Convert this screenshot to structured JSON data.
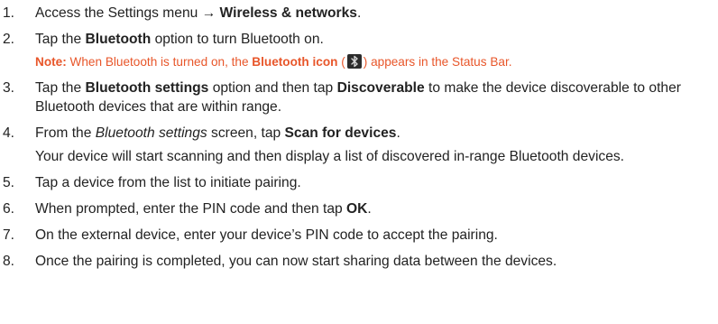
{
  "steps": [
    {
      "num": "1.",
      "pre": "Access the Settings menu → ",
      "b1": "Wireless & networks",
      "post": "."
    },
    {
      "num": "2.",
      "pre": "Tap the ",
      "b1": "Bluetooth",
      "post": " option to turn Bluetooth on."
    },
    {
      "num": "3.",
      "pre": "Tap the ",
      "b1": "Bluetooth settings",
      "mid": " option and then tap ",
      "b2": "Discoverable",
      "post": " to make the device discoverable to other Bluetooth devices that are within range."
    },
    {
      "num": "4.",
      "pre": "From the ",
      "i1": "Bluetooth settings",
      "mid": " screen, tap ",
      "b1": "Scan for devices",
      "post": ".",
      "cont": "Your device will start scanning and then display a list of discovered in-range Bluetooth devices."
    },
    {
      "num": "5.",
      "text": "Tap a device from the list to initiate pairing."
    },
    {
      "num": "6.",
      "pre": "When prompted, enter the PIN code and then tap ",
      "b1": "OK",
      "post": "."
    },
    {
      "num": "7.",
      "text": "On the external device, enter your device’s PIN code to accept the pairing."
    },
    {
      "num": "8.",
      "text": "Once the pairing is completed, you can now start sharing data between the devices."
    }
  ],
  "note": {
    "label": "Note:",
    "pre": " When Bluetooth is turned on, the ",
    "bold": "Bluetooth icon",
    "open": " (",
    "icon": "bluetooth-icon",
    "close": ") appears in the Status Bar."
  }
}
